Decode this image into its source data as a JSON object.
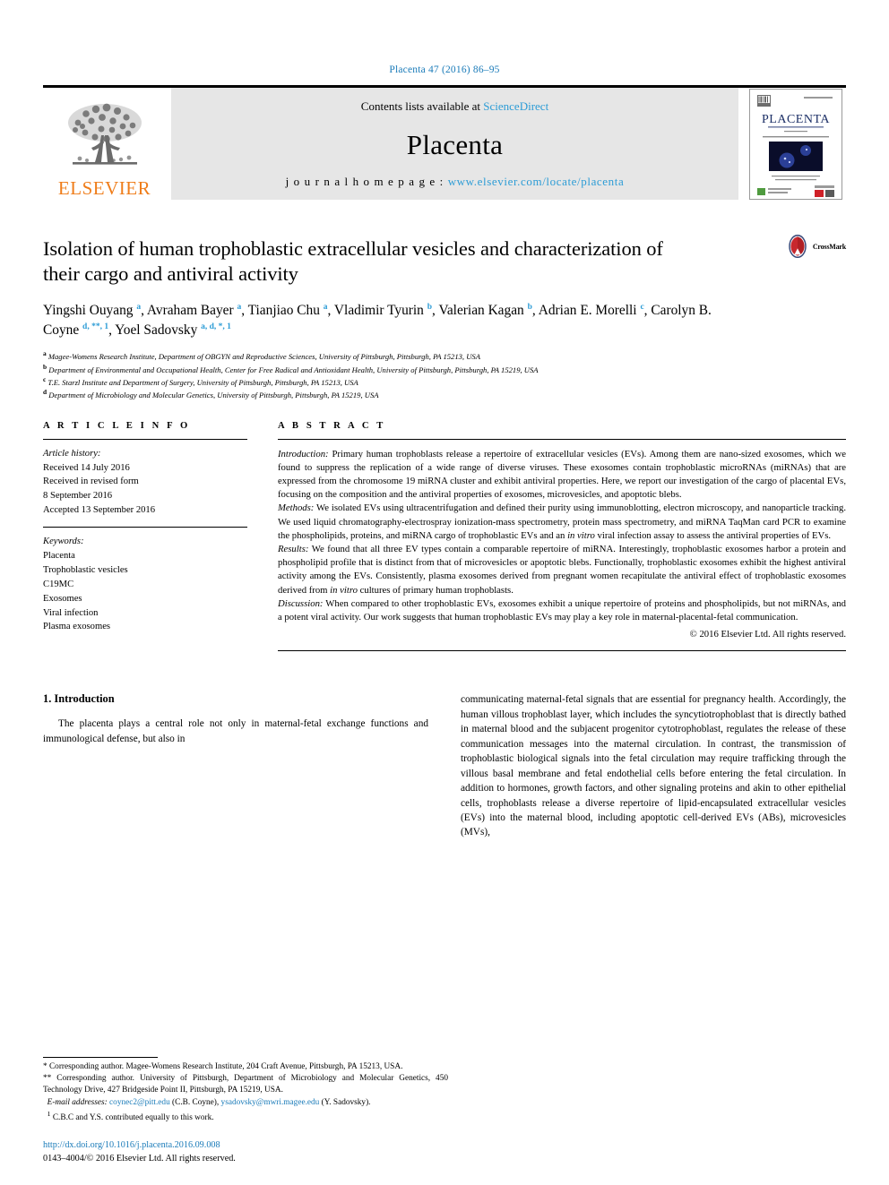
{
  "running_head": "Placenta 47 (2016) 86–95",
  "masthead": {
    "publisher_word": "ELSEVIER",
    "contents_prefix": "Contents lists available at ",
    "contents_link": "ScienceDirect",
    "journal_name": "Placenta",
    "homepage_prefix": "j o u r n a l   h o m e p a g e :  ",
    "homepage_url": "www.elsevier.com/locate/placenta",
    "cover_title": "PLACENTA"
  },
  "article": {
    "title": "Isolation of human trophoblastic extracellular vesicles and characterization of their cargo and antiviral activity",
    "crossmark_label": "CrossMark",
    "authors_html": "Yingshi Ouyang <sup>a</sup>, Avraham Bayer <sup>a</sup>, Tianjiao Chu <sup>a</sup>, Vladimir Tyurin <sup>b</sup>, Valerian Kagan <sup>b</sup>, Adrian E. Morelli <sup>c</sup>, Carolyn B. Coyne <sup>d, **, 1</sup>, Yoel Sadovsky <sup>a, d, *, 1</sup>",
    "affiliations": [
      {
        "mark": "a",
        "text": "Magee-Womens Research Institute, Department of OBGYN and Reproductive Sciences, University of Pittsburgh, Pittsburgh, PA 15213, USA"
      },
      {
        "mark": "b",
        "text": "Department of Environmental and Occupational Health, Center for Free Radical and Antioxidant Health, University of Pittsburgh, Pittsburgh, PA 15219, USA"
      },
      {
        "mark": "c",
        "text": "T.E. Starzl Institute and Department of Surgery, University of Pittsburgh, Pittsburgh, PA 15213, USA"
      },
      {
        "mark": "d",
        "text": "Department of Microbiology and Molecular Genetics, University of Pittsburgh, Pittsburgh, PA 15219, USA"
      }
    ]
  },
  "article_info": {
    "heading": "A R T I C L E   I N F O",
    "history_label": "Article history:",
    "history": [
      "Received 14 July 2016",
      "Received in revised form",
      "8 September 2016",
      "Accepted 13 September 2016"
    ],
    "keywords_label": "Keywords:",
    "keywords": [
      "Placenta",
      "Trophoblastic vesicles",
      "C19MC",
      "Exosomes",
      "Viral infection",
      "Plasma exosomes"
    ]
  },
  "abstract": {
    "heading": "A B S T R A C T",
    "sections": [
      {
        "lead": "Introduction:",
        "text": " Primary human trophoblasts release a repertoire of extracellular vesicles (EVs). Among them are nano-sized exosomes, which we found to suppress the replication of a wide range of diverse viruses. These exosomes contain trophoblastic microRNAs (miRNAs) that are expressed from the chromosome 19 miRNA cluster and exhibit antiviral properties. Here, we report our investigation of the cargo of placental EVs, focusing on the composition and the antiviral properties of exosomes, microvesicles, and apoptotic blebs."
      },
      {
        "lead": "Methods:",
        "text": " We isolated EVs using ultracentrifugation and defined their purity using immunoblotting, electron microscopy, and nanoparticle tracking. We used liquid chromatography-electrospray ionization-mass spectrometry, protein mass spectrometry, and miRNA TaqMan card PCR to examine the phospholipids, proteins, and miRNA cargo of trophoblastic EVs and an in vitro viral infection assay to assess the antiviral properties of EVs."
      },
      {
        "lead": "Results:",
        "text": " We found that all three EV types contain a comparable repertoire of miRNA. Interestingly, trophoblastic exosomes harbor a protein and phospholipid profile that is distinct from that of microvesicles or apoptotic blebs. Functionally, trophoblastic exosomes exhibit the highest antiviral activity among the EVs. Consistently, plasma exosomes derived from pregnant women recapitulate the antiviral effect of trophoblastic exosomes derived from in vitro cultures of primary human trophoblasts."
      },
      {
        "lead": "Discussion:",
        "text": " When compared to other trophoblastic EVs, exosomes exhibit a unique repertoire of proteins and phospholipids, but not miRNAs, and a potent viral activity. Our work suggests that human trophoblastic EVs may play a key role in maternal-placental-fetal communication."
      }
    ],
    "copyright": "© 2016 Elsevier Ltd. All rights reserved."
  },
  "body": {
    "section_number_title": "1. Introduction",
    "left_paragraph": "The placenta plays a central role not only in maternal-fetal exchange functions and immunological defense, but also in",
    "right_paragraph": "communicating maternal-fetal signals that are essential for pregnancy health. Accordingly, the human villous trophoblast layer, which includes the syncytiotrophoblast that is directly bathed in maternal blood and the subjacent progenitor cytotrophoblast, regulates the release of these communication messages into the maternal circulation. In contrast, the transmission of trophoblastic biological signals into the fetal circulation may require trafficking through the villous basal membrane and fetal endothelial cells before entering the fetal circulation. In addition to hormones, growth factors, and other signaling proteins and akin to other epithelial cells, trophoblasts release a diverse repertoire of lipid-encapsulated extracellular vesicles (EVs) into the maternal blood, including apoptotic cell-derived EVs (ABs), microvesicles (MVs),"
  },
  "footnotes": {
    "corresponding_1_mark": "*",
    "corresponding_1": " Corresponding author. Magee-Womens Research Institute, 204 Craft Avenue, Pittsburgh, PA 15213, USA.",
    "corresponding_2_mark": "**",
    "corresponding_2": " Corresponding author. University of Pittsburgh, Department of Microbiology and Molecular Genetics, 450 Technology Drive, 427 Bridgeside Point II, Pittsburgh, PA 15219, USA.",
    "email_label": "E-mail addresses:",
    "email_1": "coynec2@pitt.edu",
    "email_1_owner": " (C.B. Coyne), ",
    "email_2": "ysadovsky@mwri.magee.edu",
    "email_2_owner": " (Y. Sadovsky).",
    "equal_mark": "1",
    "equal_contrib": " C.B.C and Y.S. contributed equally to this work."
  },
  "doi_block": {
    "doi": "http://dx.doi.org/10.1016/j.placenta.2016.09.008",
    "issn": "0143–4004/© 2016 Elsevier Ltd. All rights reserved."
  },
  "colors": {
    "link_blue": "#1a7bb9",
    "sd_blue": "#2c9cd6",
    "elsevier_orange": "#ef7d1a"
  }
}
